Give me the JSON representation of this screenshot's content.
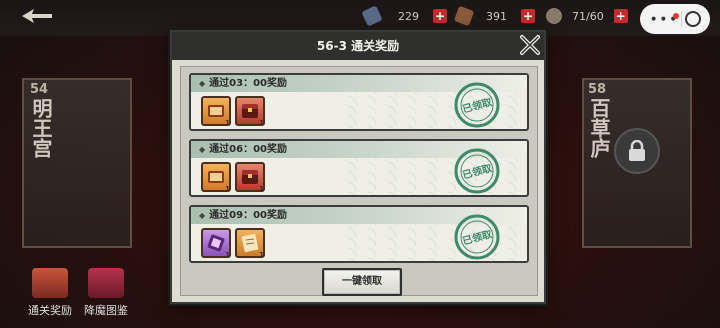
{
  "top_bar": {
    "currency1": {
      "value": "229",
      "icon": "scroll-currency-icon"
    },
    "currency2": {
      "value": "391",
      "icon": "sword-currency-icon"
    },
    "stamina": {
      "value": "71/60",
      "icon": "stamina-icon"
    },
    "plus_label": "+"
  },
  "stages": [
    {
      "num": "54",
      "title": "明王宫"
    },
    {
      "num": "58",
      "title": "百草庐"
    }
  ],
  "bottom_buttons": [
    {
      "label": "通关奖励"
    },
    {
      "label": "降魔图鉴"
    }
  ],
  "modal": {
    "title": "56-3 通关奖励",
    "rewards": [
      {
        "header": "通过03：00奖励",
        "items": [
          {
            "kind": "gold",
            "icon": "scroll-item-icon",
            "qty": "1"
          },
          {
            "kind": "red",
            "icon": "chest-item-icon",
            "qty": "1"
          }
        ],
        "status": "已领取"
      },
      {
        "header": "通过06：00奖励",
        "items": [
          {
            "kind": "gold",
            "icon": "scroll-item-icon",
            "qty": "1"
          },
          {
            "kind": "red",
            "icon": "chest-item-icon",
            "qty": "1"
          }
        ],
        "status": "已领取"
      },
      {
        "header": "通过09：00奖励",
        "items": [
          {
            "kind": "purple",
            "icon": "purple-scroll-item-icon",
            "qty": "1"
          },
          {
            "kind": "gold",
            "icon": "paper-scroll-item-icon",
            "qty": "1"
          }
        ],
        "status": "已领取"
      }
    ],
    "claim_all_label": "一键领取"
  },
  "colors": {
    "modal_bg": "#dcdcd2",
    "header_bg": "#2f2f2d",
    "stamp_green": "#3f8a6a",
    "plus_red": "#c42b2b"
  }
}
